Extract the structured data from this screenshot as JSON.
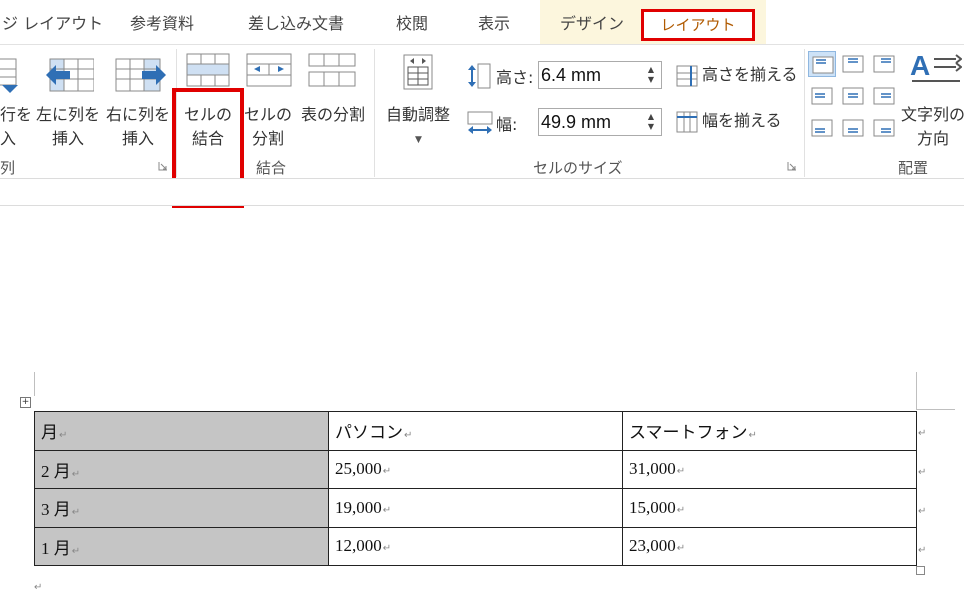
{
  "tabs": {
    "page_layout_partial": "ジ レイアウト",
    "references": "参考資料",
    "mailings": "差し込み文書",
    "review": "校閲",
    "view": "表示",
    "design": "デザイン",
    "layout": "レイアウト"
  },
  "ribbon": {
    "rows_cols": {
      "insert_below_line1": "行を",
      "insert_below_line2": "入",
      "insert_left_line1": "左に列を",
      "insert_left_line2": "挿入",
      "insert_right_line1": "右に列を",
      "insert_right_line2": "挿入",
      "group_label_partial": "列"
    },
    "merge": {
      "merge_cells_line1": "セルの",
      "merge_cells_line2": "結合",
      "split_cells_line1": "セルの",
      "split_cells_line2": "分割",
      "split_table": "表の分割",
      "group_label": "結合"
    },
    "cell_size": {
      "autofit": "自動調整",
      "height_label": "高さ:",
      "height_value": "6.4 mm",
      "width_label": "幅:",
      "width_value": "49.9 mm",
      "distribute_rows": "高さを揃える",
      "distribute_cols": "幅を揃える",
      "group_label": "セルのサイズ"
    },
    "alignment": {
      "text_direction_line1": "文字列の",
      "text_direction_line2": "方向",
      "group_label": "配置"
    }
  },
  "table": {
    "header": [
      "月",
      "パソコン",
      "スマートフォン"
    ],
    "rows": [
      [
        "2 月",
        "25,000",
        "31,000"
      ],
      [
        "3 月",
        "19,000",
        "15,000"
      ],
      [
        "1 月",
        "12,000",
        "23,000"
      ]
    ]
  },
  "colors": {
    "highlight": "#e00000",
    "design_tab_bg": "#fcf6dd",
    "first_column_shading": "#c5c5c5",
    "icon_blue": "#2f6fb5"
  }
}
